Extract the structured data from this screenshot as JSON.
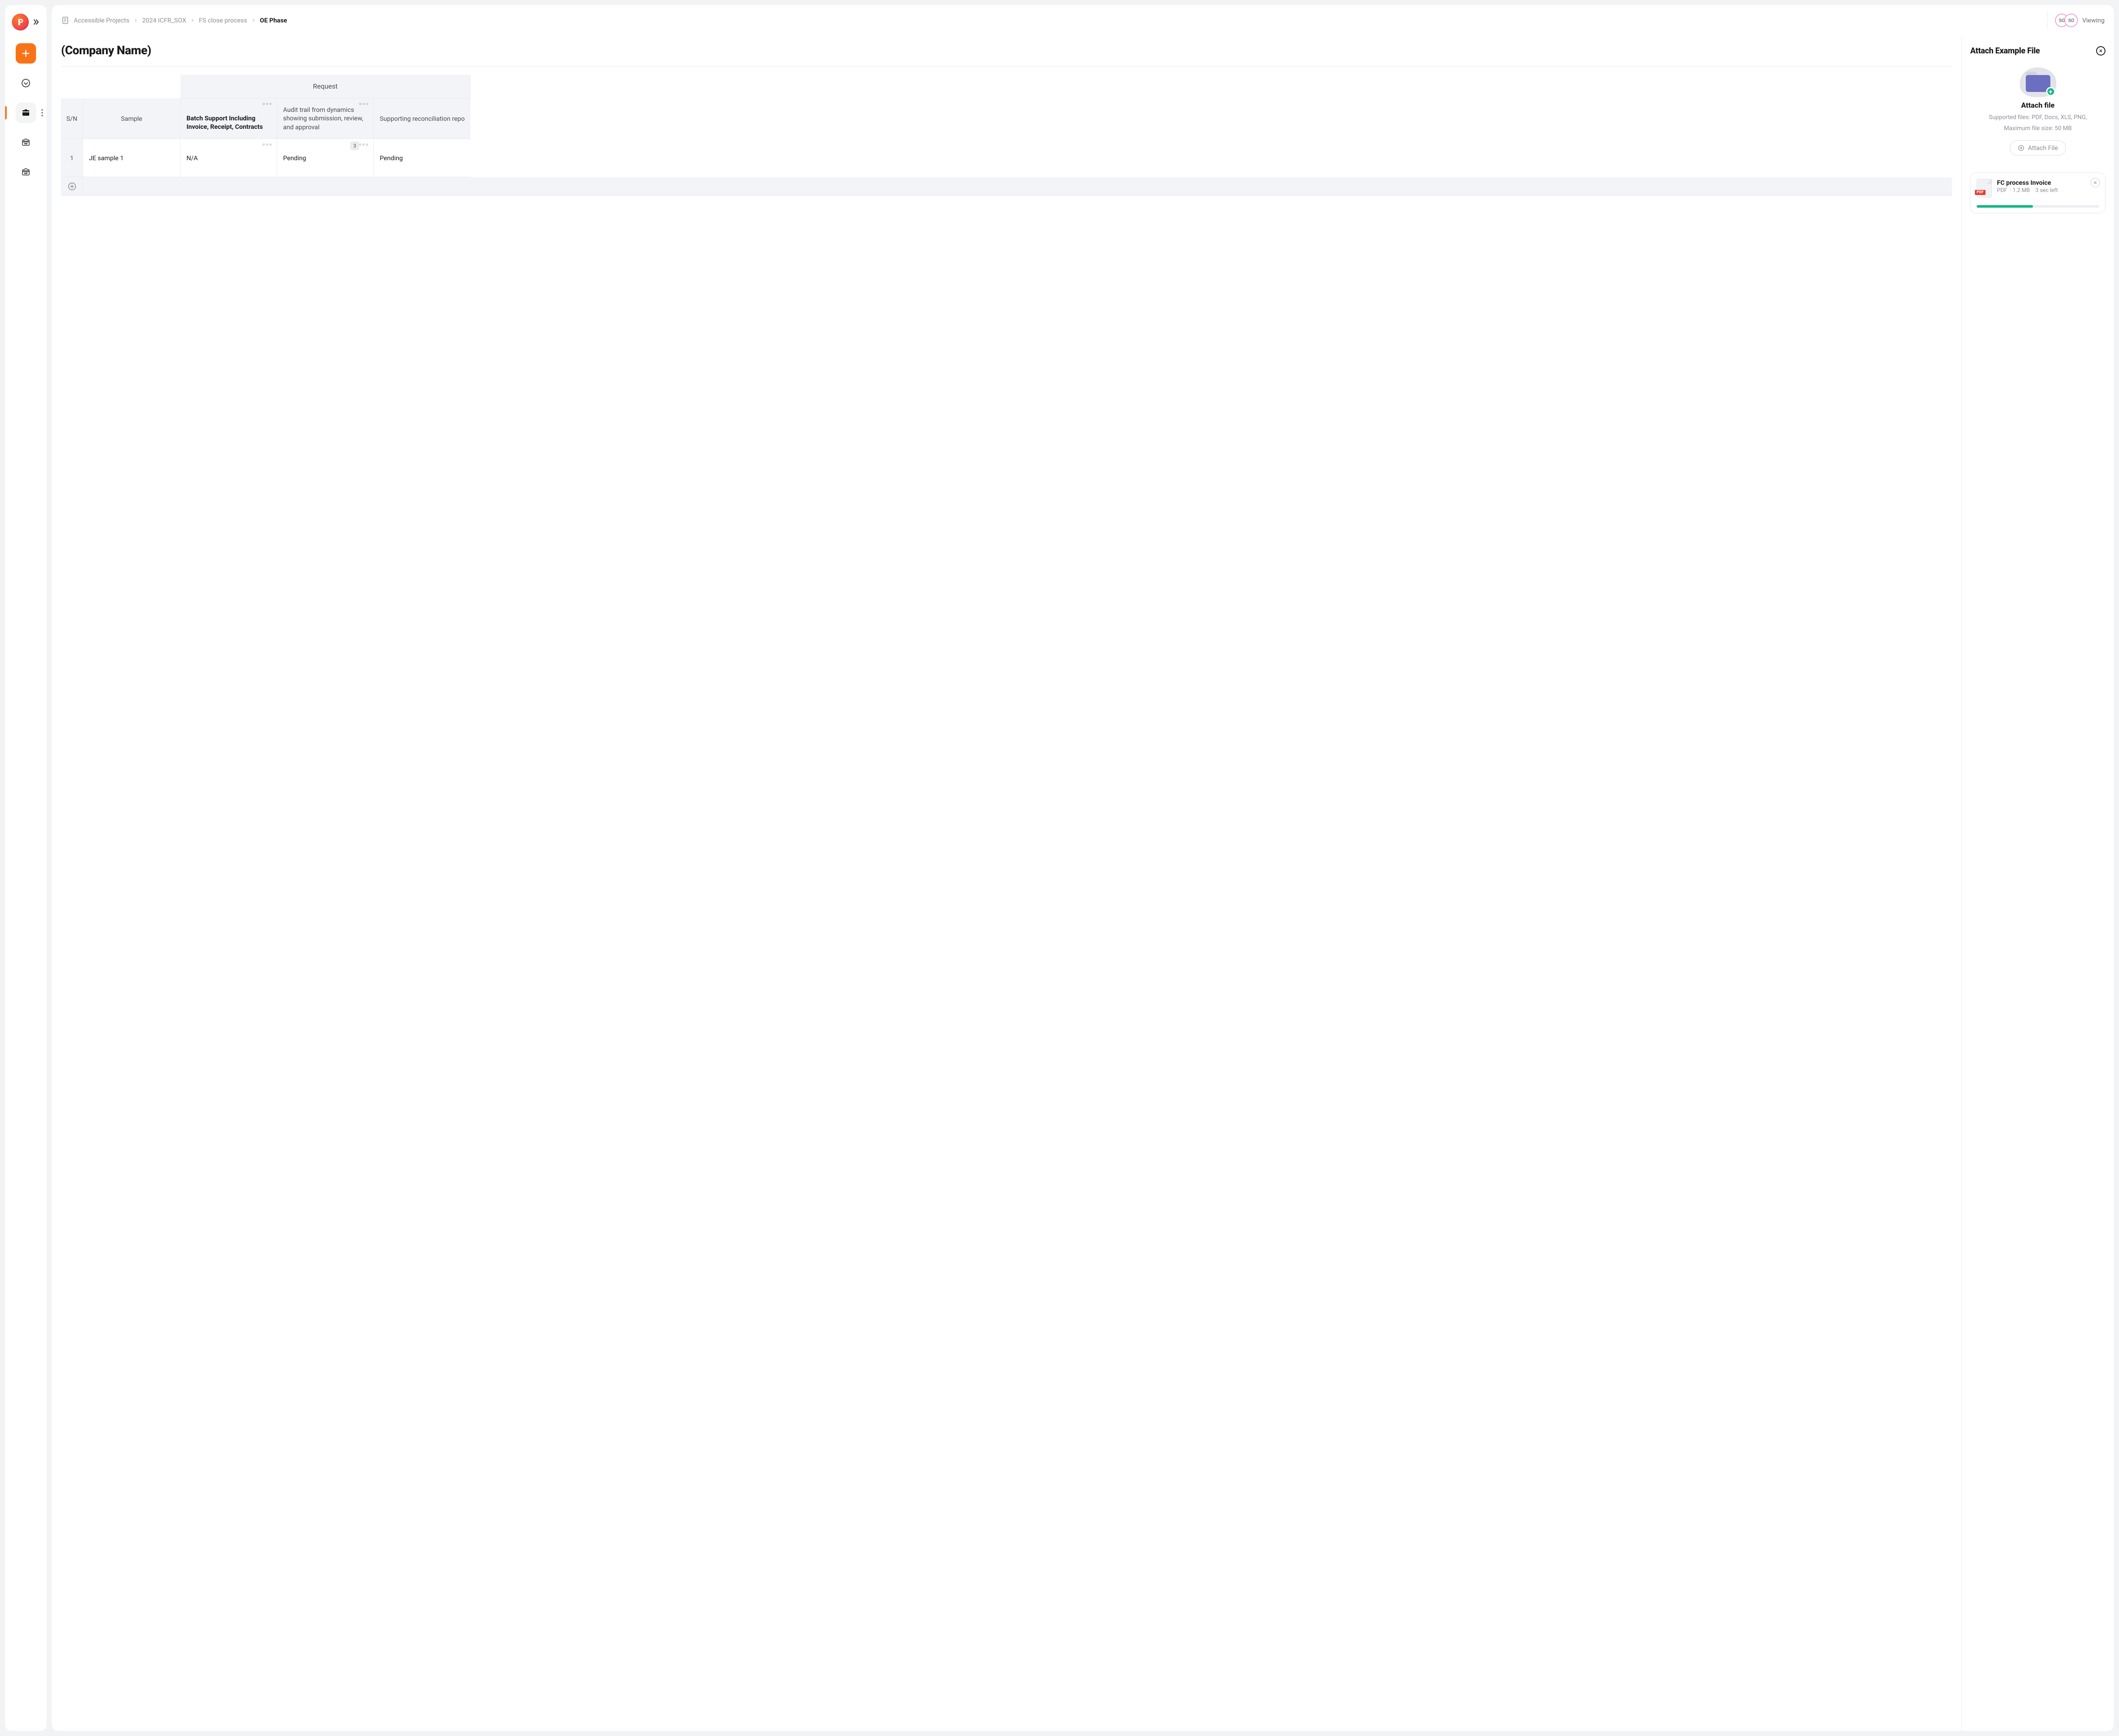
{
  "breadcrumb": {
    "items": [
      "Accessible Projects",
      "2024 ICFR_SOX",
      "FS close process"
    ],
    "current": "OE Phase"
  },
  "viewers": {
    "avatars": [
      "SO",
      "SO"
    ],
    "label": "Viewing"
  },
  "page": {
    "title": "(Company Name)"
  },
  "table": {
    "group_header": "Request",
    "sn_header": "S/N",
    "sample_header": "Sample",
    "columns": [
      "Batch Support Including Invoice, Receipt, Contracts",
      "Audit trail from dynamics showing submission, review, and approval",
      "Supporting reconciliation report, showing that t"
    ],
    "rows": [
      {
        "sn": "1",
        "sample": "JE sample 1",
        "cells": [
          "N/A",
          "Pending",
          "Pending"
        ],
        "badge_index": 1,
        "badge_value": "3"
      }
    ]
  },
  "panel": {
    "title": "Attach Example File",
    "attach_title": "Attach file",
    "supported": "Supported files: PDF, Docs, XLS, PNG,",
    "max_size": "Maximum file size: 50 MB",
    "button_label": "Attach File",
    "upload": {
      "name": "FC process Invoice",
      "type": "PDF",
      "size": "1.2 MB",
      "eta": "3 sec left",
      "progress_pct": 46
    }
  }
}
